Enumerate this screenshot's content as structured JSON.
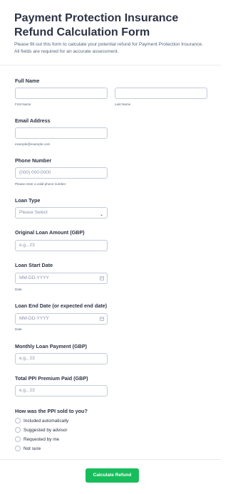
{
  "form": {
    "title": "Payment Protection Insurance Refund Calculation Form",
    "description": "Please fill out this form to calculate your potential refund for Payment Protection Insurance. All fields are required for an accurate assessment."
  },
  "fields": {
    "full_name": {
      "label": "Full Name",
      "first_sub": "First Name",
      "last_sub": "Last Name",
      "first_value": "",
      "last_value": ""
    },
    "email": {
      "label": "Email Address",
      "sub": "example@example.com",
      "value": ""
    },
    "phone": {
      "label": "Phone Number",
      "placeholder": "(000) 000-0000",
      "sub": "Please enter a valid phone number."
    },
    "loan_type": {
      "label": "Loan Type",
      "selected": "Please Select"
    },
    "original_loan": {
      "label": "Original Loan Amount (GBP)",
      "placeholder": "e.g., 23"
    },
    "loan_start": {
      "label": "Loan Start Date",
      "placeholder": "MM-DD-YYYY",
      "sub": "Date"
    },
    "loan_end": {
      "label": "Loan End Date (or expected end date)",
      "placeholder": "MM-DD-YYYY",
      "sub": "Date"
    },
    "monthly_payment": {
      "label": "Monthly Loan Payment (GBP)",
      "placeholder": "e.g., 23"
    },
    "ppi_premium": {
      "label": "Total PPI Premium Paid (GBP)",
      "placeholder": "e.g., 23"
    },
    "ppi_sold": {
      "label": "How was the PPI sold to you?",
      "options": [
        "Included automatically",
        "Suggested by advisor",
        "Requested by me",
        "Not sure"
      ]
    }
  },
  "submit": {
    "label": "Calculate Refund"
  },
  "icons": {
    "date": "calendar-icon",
    "select": "chevron-down-icon"
  },
  "colors": {
    "submit_bg": "#18bd5b",
    "text": "#2c3345",
    "border": "#c3cad8"
  }
}
